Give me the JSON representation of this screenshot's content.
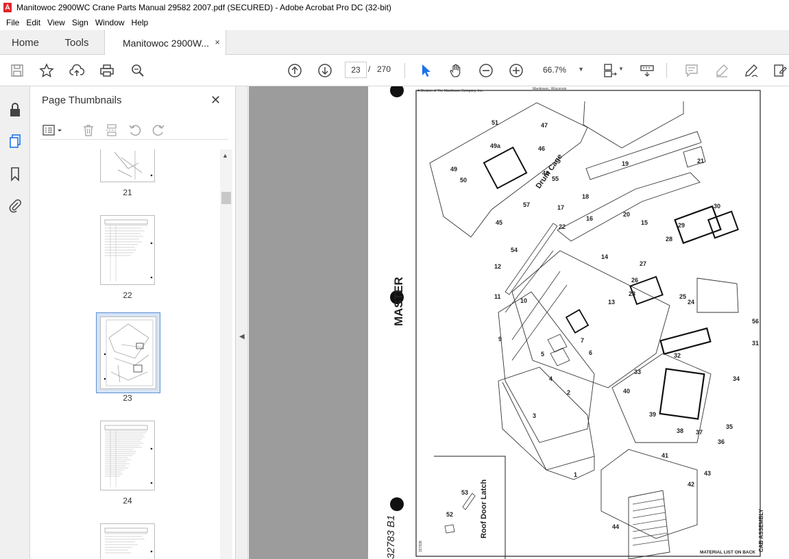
{
  "window": {
    "title": "Manitowoc 2900WC Crane Parts Manual 29582 2007.pdf (SECURED) - Adobe Acrobat Pro DC (32-bit)"
  },
  "menu": [
    "File",
    "Edit",
    "View",
    "Sign",
    "Window",
    "Help"
  ],
  "tabs": {
    "home": "Home",
    "tools": "Tools",
    "document": "Manitowoc 2900W...",
    "close": "×"
  },
  "toolbar": {
    "current_page": "23",
    "page_separator": "/",
    "total_pages": "270",
    "zoom": "66.7%"
  },
  "thumbnail_panel": {
    "title": "Page Thumbnails",
    "close": "✕",
    "pages": [
      {
        "label": "21"
      },
      {
        "label": "22"
      },
      {
        "label": "23",
        "selected": true
      },
      {
        "label": "24"
      }
    ]
  },
  "document_page": {
    "header_left": "A Division of The Manitowoc Company, Inc.",
    "header_right": "Manitowoc, Wisconsin",
    "stamp": "MASTER",
    "drawing_number": "32783 B1",
    "inset_caption": "Roof Door Latch",
    "cage_label": "Drum Cage",
    "footer_right": "MATERIAL LIST ON BACK",
    "title_block": "CAB ASSEMBLY",
    "ref_number": "327838",
    "callouts": [
      "1",
      "2",
      "3",
      "4",
      "5",
      "6",
      "7",
      "9",
      "10",
      "11",
      "12",
      "13",
      "14",
      "15",
      "16",
      "17",
      "18",
      "19",
      "20",
      "21",
      "22",
      "23",
      "24",
      "25",
      "26",
      "27",
      "28",
      "29",
      "30",
      "31",
      "32",
      "33",
      "34",
      "35",
      "36",
      "37",
      "38",
      "39",
      "40",
      "41",
      "42",
      "43",
      "44",
      "45",
      "46",
      "47",
      "48",
      "49",
      "49a",
      "50",
      "51",
      "52",
      "53",
      "54",
      "55",
      "56",
      "57"
    ]
  },
  "colors": {
    "accent": "#1a73e8",
    "viewer_bg": "#9c9c9c",
    "chrome_bg": "#f0f0f0"
  }
}
